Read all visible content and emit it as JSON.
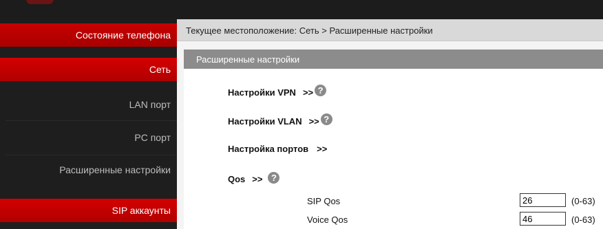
{
  "sidebar": {
    "items": [
      {
        "label": "Состояние телефона",
        "active": true
      },
      {
        "label": "Сеть",
        "active": true
      },
      {
        "label": "LAN порт",
        "active": false
      },
      {
        "label": "PC порт",
        "active": false
      },
      {
        "label": "Расширенные настройки",
        "active": false
      },
      {
        "label": "SIP аккаунты",
        "active": true
      }
    ]
  },
  "breadcrumb": "Текущее местоположение: Сеть > Расширенные настройки",
  "panel": {
    "title": "Расширенные настройки",
    "sections": [
      {
        "label": "Настройки VPN",
        "arrows": ">>",
        "help_icon": "question-circle-icon"
      },
      {
        "label": "Настройки VLAN",
        "arrows": ">>",
        "help_icon": "question-circle-icon"
      },
      {
        "label": "Настройка портов",
        "arrows": ">>"
      },
      {
        "label": "Qos",
        "arrows": ">>",
        "help_icon": "question-circle-icon"
      }
    ],
    "qos_fields": [
      {
        "label": "SIP Qos",
        "value": "26",
        "range": "(0-63)"
      },
      {
        "label": "Voice Qos",
        "value": "46",
        "range": "(0-63)"
      }
    ]
  },
  "colors": {
    "accent_red": "#c80000",
    "sidebar_bg": "#1e1e1e",
    "panel_header": "#8c8c8c"
  }
}
